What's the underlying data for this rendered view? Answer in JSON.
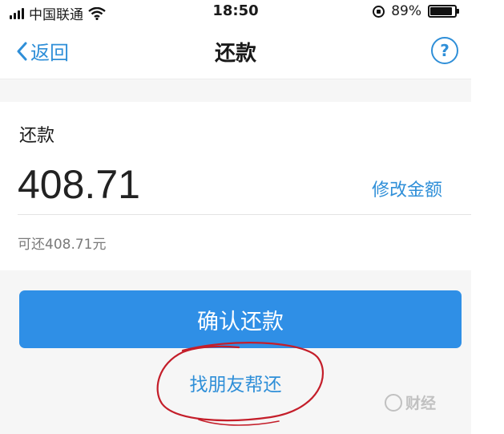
{
  "status_bar": {
    "carrier": "中国联通",
    "time": "18:50",
    "battery_text": "89%",
    "battery_level": 0.89
  },
  "nav": {
    "back_label": "返回",
    "title": "还款",
    "help_symbol": "?"
  },
  "repayment": {
    "label": "还款",
    "amount": "408.71",
    "edit_label": "修改金额",
    "available_text": "可还408.71元"
  },
  "actions": {
    "confirm_label": "确认还款",
    "ask_friend_label": "找朋友帮还"
  },
  "watermark": {
    "text": "财经"
  },
  "colors": {
    "accent": "#2f8fd8",
    "button": "#2f8fe6",
    "annotation": "#c41e2a"
  },
  "icons": [
    "signal-icon",
    "wifi-icon",
    "lock-rotation-icon",
    "battery-icon",
    "back-chevron-icon",
    "help-icon"
  ]
}
